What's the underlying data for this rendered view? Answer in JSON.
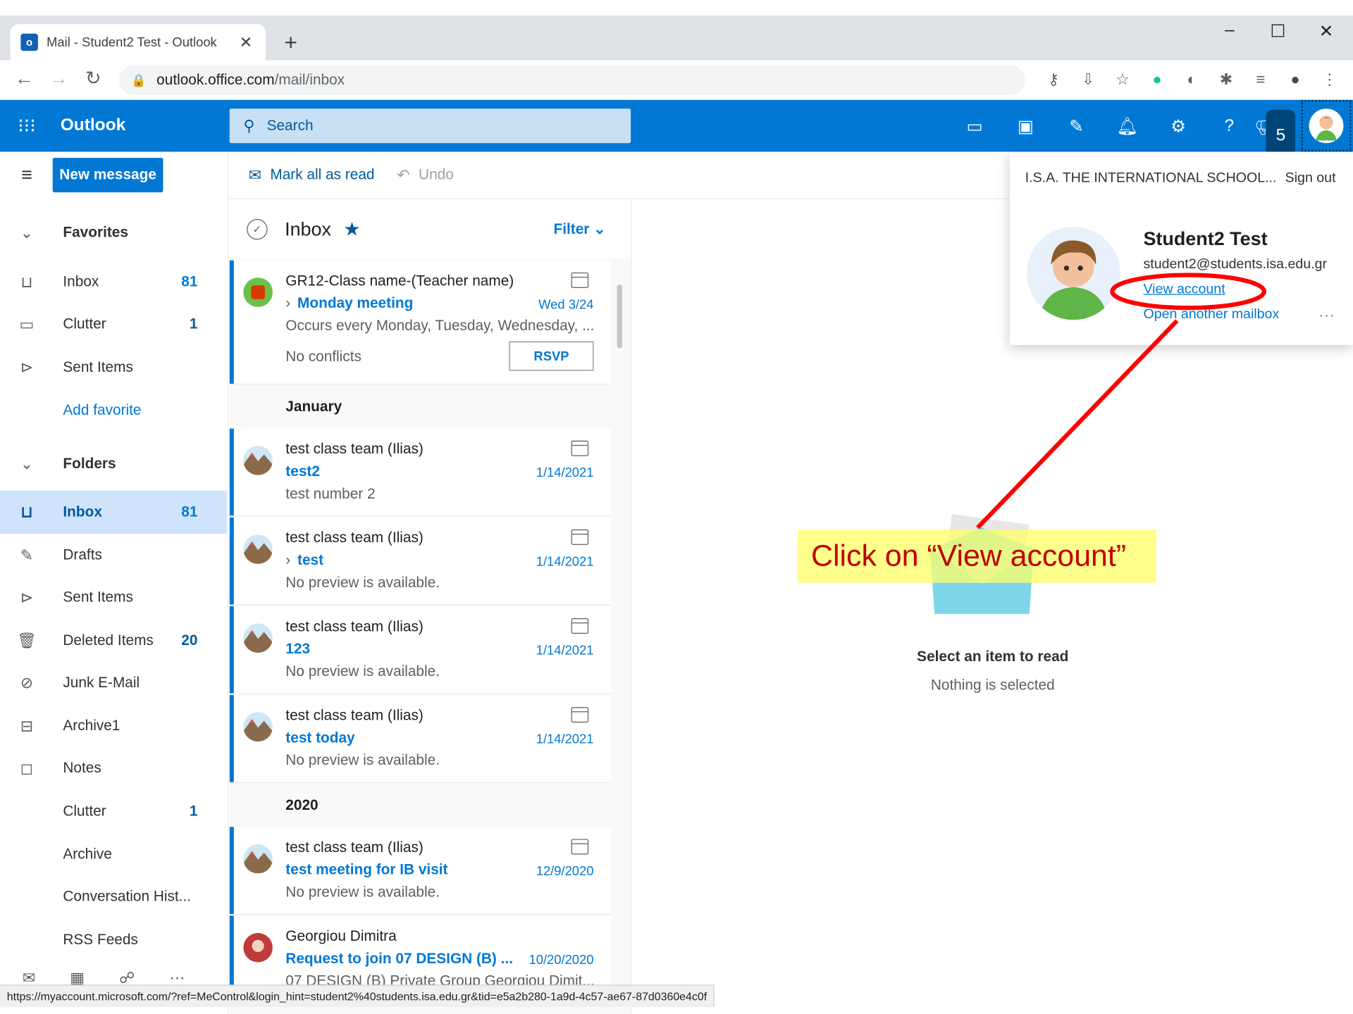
{
  "browser": {
    "tab_title": "Mail - Student2 Test - Outlook",
    "tab_close": "✕",
    "new_tab": "+",
    "url_host": "outlook.office.com",
    "url_path": "/mail/inbox",
    "window_min": "–",
    "window_max": "☐",
    "window_close": "✕"
  },
  "outlook": {
    "brand": "Outlook",
    "search_placeholder": "Search",
    "new_message": "New message",
    "notification_count": "5"
  },
  "commands": {
    "mark_all_read": "Mark all as read",
    "undo": "Undo"
  },
  "leftnav": {
    "favorites": {
      "header": "Favorites",
      "items": [
        {
          "label": "Inbox",
          "count": "81"
        },
        {
          "label": "Clutter",
          "count": "1"
        },
        {
          "label": "Sent Items",
          "count": ""
        },
        {
          "label": "Add favorite",
          "count": ""
        }
      ]
    },
    "folders": {
      "header": "Folders",
      "items": [
        {
          "label": "Inbox",
          "count": "81"
        },
        {
          "label": "Drafts",
          "count": ""
        },
        {
          "label": "Sent Items",
          "count": ""
        },
        {
          "label": "Deleted Items",
          "count": "20"
        },
        {
          "label": "Junk E-Mail",
          "count": ""
        },
        {
          "label": "Archive1",
          "count": ""
        },
        {
          "label": "Notes",
          "count": ""
        },
        {
          "label": "Clutter",
          "count": "1"
        },
        {
          "label": "Archive",
          "count": ""
        },
        {
          "label": "Conversation Hist...",
          "count": ""
        },
        {
          "label": "RSS Feeds",
          "count": ""
        }
      ]
    }
  },
  "inbox": {
    "title": "Inbox",
    "filter": "Filter",
    "pinned": {
      "sender": "GR12-Class name-(Teacher name)",
      "subject": "Monday meeting",
      "date": "Wed 3/24",
      "preview": "Occurs every Monday, Tuesday, Wednesday, ...",
      "conflicts": "No conflicts",
      "rsvp": "RSVP"
    },
    "groups": [
      "January",
      "2020"
    ],
    "messages": [
      {
        "sender": "test class team (Ilias)",
        "subject": "test2",
        "date": "1/14/2021",
        "preview": "test number 2"
      },
      {
        "sender": "test class team (Ilias)",
        "subject": "test",
        "date": "1/14/2021",
        "preview": "No preview is available."
      },
      {
        "sender": "test class team (Ilias)",
        "subject": "123",
        "date": "1/14/2021",
        "preview": "No preview is available."
      },
      {
        "sender": "test class team (Ilias)",
        "subject": "test today",
        "date": "1/14/2021",
        "preview": "No preview is available."
      },
      {
        "sender": "test class team (Ilias)",
        "subject": "test meeting for IB visit",
        "date": "12/9/2020",
        "preview": "No preview is available."
      },
      {
        "sender": "Georgiou Dimitra",
        "subject": "Request to join 07 DESIGN (B) ...",
        "date": "10/20/2020",
        "preview": "07 DESIGN (B) Private Group Georgiou Dimit..."
      }
    ]
  },
  "reading": {
    "title": "Select an item to read",
    "subtitle": "Nothing is selected"
  },
  "me_panel": {
    "org": "I.S.A. THE INTERNATIONAL SCHOOL...",
    "sign_out": "Sign out",
    "name": "Student2 Test",
    "email": "student2@students.isa.edu.gr",
    "view_account": "View account",
    "open_another": "Open another mailbox",
    "more": "..."
  },
  "annotation": {
    "callout": "Click on “View account”",
    "color": "#ff0000"
  },
  "status_url": "https://myaccount.microsoft.com/?ref=MeControl&login_hint=student2%40students.isa.edu.gr&tid=e5a2b280-1a9d-4c57-ae67-87d0360e4c0f",
  "colors": {
    "brand_blue": "#0078d4",
    "search_bg": "#c7e0f4",
    "callout_bg": "#ffff66",
    "callout_text": "#c00000"
  },
  "icons": [
    "waffle-icon",
    "search-icon",
    "settings-icon",
    "help-icon",
    "bell-icon",
    "calendar-icon",
    "inbox-icon",
    "folder-icon",
    "send-icon",
    "pencil-icon",
    "trash-icon",
    "block-icon",
    "archive-icon",
    "note-icon"
  ]
}
